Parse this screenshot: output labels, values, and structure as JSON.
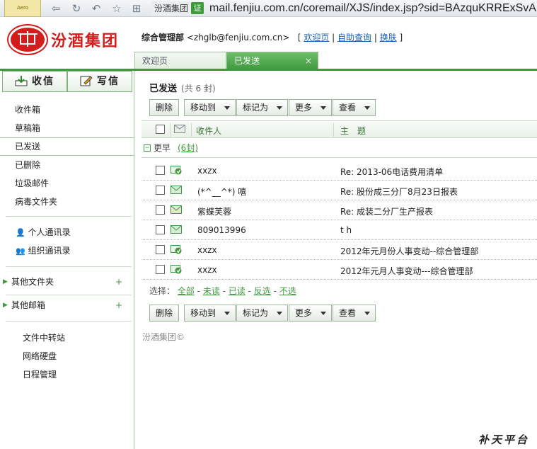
{
  "browser": {
    "tab_thumb_label": "Aero",
    "site_name": "汾酒集团",
    "cert_label": "证",
    "url": "mail.fenjiu.com.cn/coremail/XJS/index.jsp?sid=BAzquKRRExSvA"
  },
  "header": {
    "logo_text": "汾酒集团",
    "user_name": "综合管理部",
    "user_email": "<zhglb@fenjiu.com.cn>",
    "links": [
      "欢迎页",
      "自助查询",
      "换肤"
    ],
    "tabs": [
      {
        "label": "欢迎页",
        "active": false
      },
      {
        "label": "已发送",
        "active": true
      }
    ],
    "tab_close": "×"
  },
  "sidebar": {
    "receive_label": "收信",
    "compose_label": "写信",
    "folders": [
      "收件箱",
      "草稿箱",
      "已发送",
      "已删除",
      "垃圾邮件",
      "病毒文件夹"
    ],
    "selected_folder": "已发送",
    "contacts": [
      "个人通讯录",
      "组织通讯录"
    ],
    "other_folders_label": "其他文件夹",
    "other_mailbox_label": "其他邮箱",
    "plus_label": "+",
    "tools": [
      "文件中转站",
      "网络硬盘",
      "日程管理"
    ]
  },
  "main": {
    "folder_title": "已发送",
    "folder_count": "(共 6 封)",
    "toolbar": [
      {
        "label": "删除",
        "dropdown": false
      },
      {
        "label": "移动到",
        "dropdown": true
      },
      {
        "label": "标记为",
        "dropdown": true
      },
      {
        "label": "更多",
        "dropdown": true
      },
      {
        "label": "查看",
        "dropdown": true
      }
    ],
    "columns": {
      "recipient": "收件人",
      "subject": "主　题"
    },
    "group": {
      "label": "更早",
      "count": "(6封)",
      "toggle": "−"
    },
    "rows": [
      {
        "recipient": "xxzx",
        "subject": "Re: 2013-06电话费用清单",
        "icon": "mail-reply-icon"
      },
      {
        "recipient": "(*^__^*) 嘻",
        "subject": "Re: 股份成三分厂8月23日报表",
        "icon": "mail-sent-icon"
      },
      {
        "recipient": "紫蝶芙蓉",
        "subject": "Re: 成装二分厂生产报表",
        "icon": "mail-sent-icon"
      },
      {
        "recipient": "809013996",
        "subject": "t h",
        "icon": "mail-sent-icon"
      },
      {
        "recipient": "xxzx",
        "subject": "2012年元月份人事变动--综合管理部",
        "icon": "mail-reply-icon"
      },
      {
        "recipient": "xxzx",
        "subject": "2012年元月人事变动---综合管理部",
        "icon": "mail-reply-icon"
      }
    ],
    "selection": {
      "prefix": "选择：",
      "options": [
        "全部",
        "未读",
        "已读",
        "反选",
        "不选"
      ]
    },
    "copyright": "汾酒集团©"
  },
  "watermark": "补天平台",
  "colors": {
    "accent_green": "#3f9a3d",
    "brand_red": "#d31d1d",
    "link_blue": "#1a5fb4"
  }
}
